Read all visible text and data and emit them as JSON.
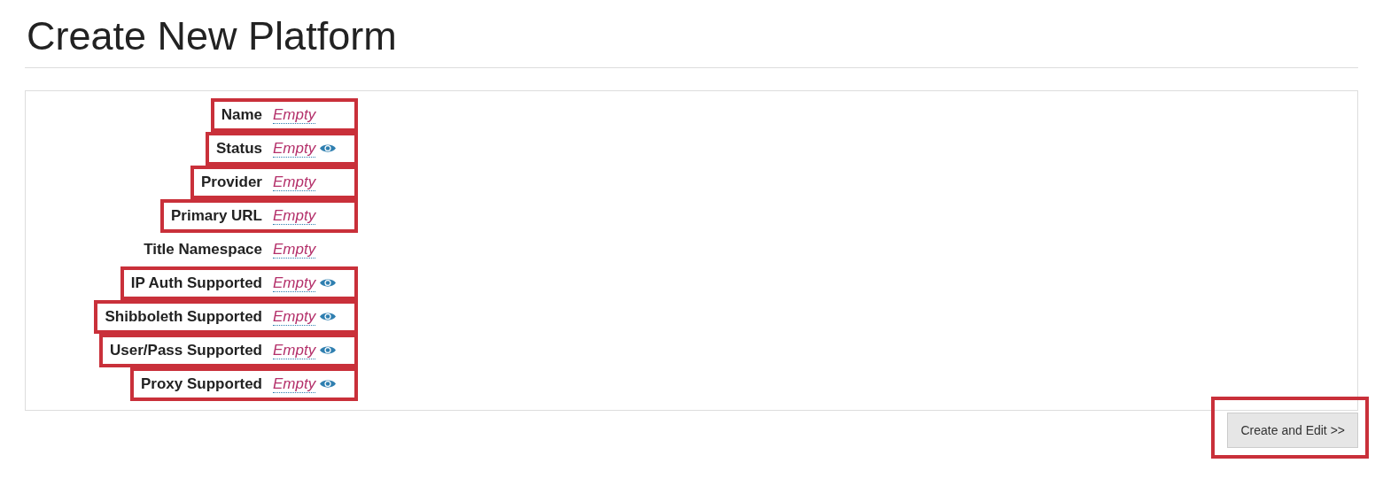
{
  "page_title": "Create New Platform",
  "fields": [
    {
      "label": "Name",
      "value": "Empty",
      "has_visibility_icon": false,
      "highlighted": true
    },
    {
      "label": "Status",
      "value": "Empty",
      "has_visibility_icon": true,
      "highlighted": true
    },
    {
      "label": "Provider",
      "value": "Empty",
      "has_visibility_icon": false,
      "highlighted": true
    },
    {
      "label": "Primary URL",
      "value": "Empty",
      "has_visibility_icon": false,
      "highlighted": true
    },
    {
      "label": "Title Namespace",
      "value": "Empty",
      "has_visibility_icon": false,
      "highlighted": false
    },
    {
      "label": "IP Auth Supported",
      "value": "Empty",
      "has_visibility_icon": true,
      "highlighted": true
    },
    {
      "label": "Shibboleth Supported",
      "value": "Empty",
      "has_visibility_icon": true,
      "highlighted": true
    },
    {
      "label": "User/Pass Supported",
      "value": "Empty",
      "has_visibility_icon": true,
      "highlighted": true
    },
    {
      "label": "Proxy Supported",
      "value": "Empty",
      "has_visibility_icon": true,
      "highlighted": true
    }
  ],
  "create_button": {
    "label": "Create and Edit >>",
    "highlighted": true
  }
}
